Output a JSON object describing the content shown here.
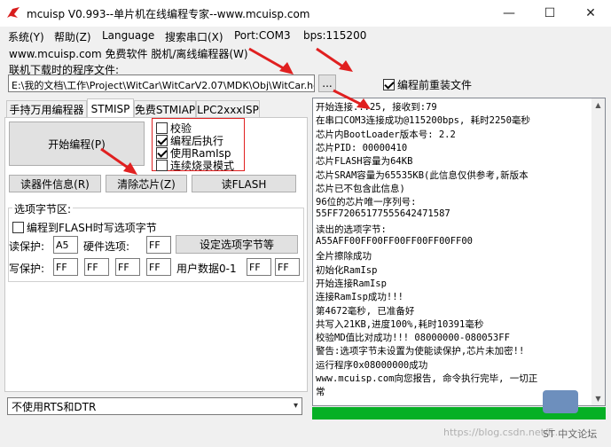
{
  "window": {
    "title": "mcuisp V0.993--单片机在线编程专家--www.mcuisp.com",
    "minimize": "—",
    "maximize": "☐",
    "close": "✕"
  },
  "menu": {
    "items": [
      "系统(Y)",
      "帮助(Z)",
      "Language",
      "搜索串口(X)",
      "Port:COM3",
      "bps:115200"
    ]
  },
  "subtitle": "www.mcuisp.com 免费软件 脱机/离线编程器(W)",
  "file": {
    "label": "联机下载时的程序文件:",
    "path": "E:\\我的文档\\工作\\Project\\WitCar\\WitCarV2.07\\MDK\\Obj\\WitCar.hex",
    "browse": "...",
    "reload_label": "编程前重装文件",
    "reload_checked": true
  },
  "tabs": [
    "手持万用编程器",
    "STMISP",
    "免费STMIAP",
    "LPC2xxxISP"
  ],
  "active_tab": "STMISP",
  "program_button": "开始编程(P)",
  "options": [
    {
      "label": "校验",
      "checked": false
    },
    {
      "label": "编程后执行",
      "checked": true
    },
    {
      "label": "使用RamIsp",
      "checked": true
    },
    {
      "label": "连续烧录模式",
      "checked": false
    }
  ],
  "buttons": {
    "read_info": "读器件信息(R)",
    "erase": "清除芯片(Z)",
    "read_flash": "读FLASH"
  },
  "option_bytes": {
    "group_label": "选项字节区:",
    "write_flash_label": "编程到FLASH时写选项字节",
    "write_flash_checked": false,
    "read_protect_label": "读保护:",
    "read_protect_value": "A5",
    "hw_option_label": "硬件选项:",
    "hw_option_value": "FF",
    "set_button": "设定选项字节等",
    "write_protect_label": "写保护:",
    "write_protect_values": [
      "FF",
      "FF",
      "FF",
      "FF"
    ],
    "user_data_label": "用户数据0-1",
    "user_data_values": [
      "FF",
      "FF"
    ]
  },
  "rts_dtr": {
    "selected": "不使用RTS和DTR"
  },
  "log_lines": [
    "开始连接...25, 接收到:79",
    "在串口COM3连接成功@115200bps, 耗时2250毫秒",
    "芯片内BootLoader版本号: 2.2",
    "芯片PID: 00000410",
    "芯片FLASH容量为64KB",
    "芯片SRAM容量为65535KB(此信息仅供参考,新版本",
    "芯片已不包含此信息)",
    "96位的芯片唯一序列号:",
    "55FF72065177555642471587",
    "读出的选项字节:",
    "A55AFF00FF00FF00FF00FF00FF00",
    "全片擦除成功",
    "初始化RamIsp",
    "开始连接RamIsp",
    "连接RamIsp成功!!!",
    "第4672毫秒, 已准备好",
    "共写入21KB,进度100%,耗时10391毫秒",
    "校验MD值比对成功!!! 08000000-080053FF",
    "警告:选项字节未设置为使能读保护,芯片未加密!!",
    "运行程序0x08000000成功",
    "www.mcuisp.com向您报告, 命令执行完毕, 一切正",
    "常"
  ],
  "progress_percent": 100,
  "watermark": "https://blog.csdn.net/F...",
  "corner_badge": "ST 中文论坛",
  "colors": {
    "progress": "#06b025",
    "arrow": "#e02020",
    "title_icon": "#d81e1e"
  }
}
